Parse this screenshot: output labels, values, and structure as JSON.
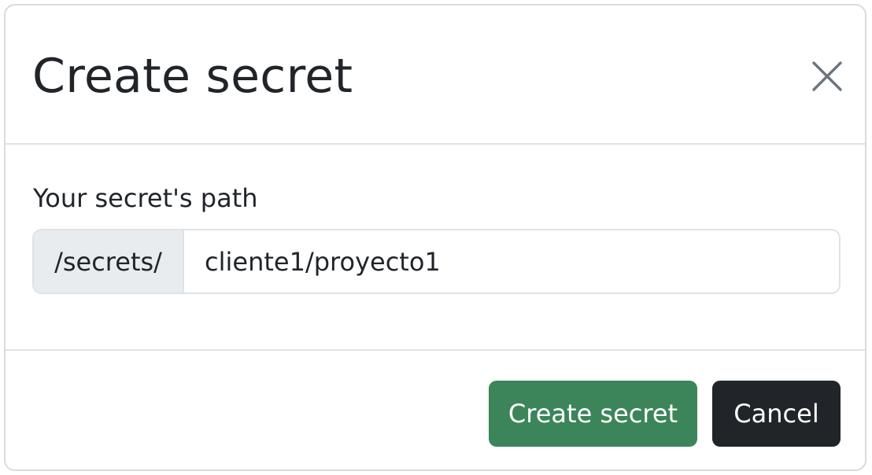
{
  "modal": {
    "title": "Create secret",
    "close_icon": "close-icon"
  },
  "form": {
    "path_label": "Your secret's path",
    "path_prefix": "/secrets/",
    "path_value": "cliente1/proyecto1",
    "path_placeholder": ""
  },
  "footer": {
    "create_label": "Create secret",
    "cancel_label": "Cancel"
  },
  "colors": {
    "create_button": "#3c855a",
    "cancel_button": "#212529",
    "prefix_background": "#e9ecef",
    "border": "#dee2e6"
  }
}
